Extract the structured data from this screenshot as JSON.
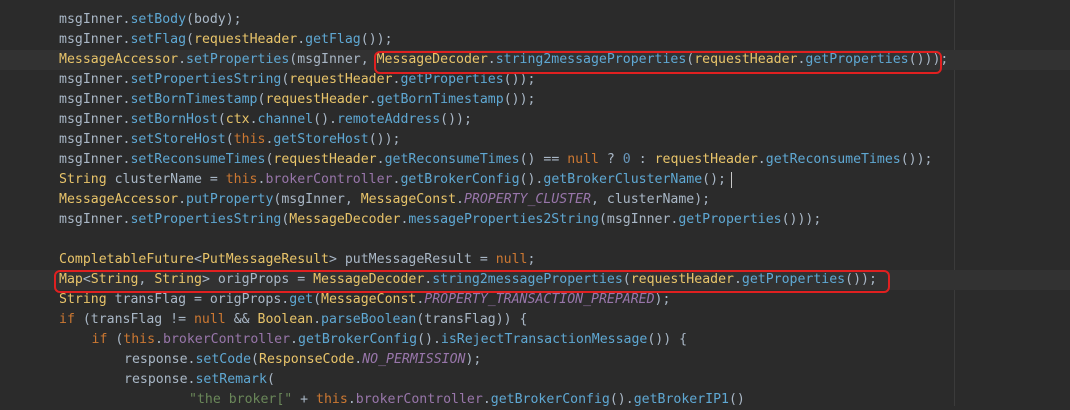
{
  "editor": {
    "lines": [
      {
        "indent": 2,
        "tokens": [
          {
            "t": "msgInner.",
            "c": "default"
          },
          {
            "t": "setBody",
            "c": "mcall"
          },
          {
            "t": "(body);",
            "c": "default"
          }
        ]
      },
      {
        "indent": 2,
        "tokens": [
          {
            "t": "msgInner.",
            "c": "default"
          },
          {
            "t": "setFlag",
            "c": "mcall"
          },
          {
            "t": "(",
            "c": "default"
          },
          {
            "t": "requestHeader",
            "c": "yellowclass"
          },
          {
            "t": ".",
            "c": "default"
          },
          {
            "t": "getFlag",
            "c": "mcall"
          },
          {
            "t": "());",
            "c": "default"
          }
        ]
      },
      {
        "indent": 2,
        "current": true,
        "tokens": [
          {
            "t": "MessageAccessor",
            "c": "yellowclass"
          },
          {
            "t": ".",
            "c": "default"
          },
          {
            "t": "setProperties",
            "c": "mcall"
          },
          {
            "t": "(msgInner, ",
            "c": "default"
          },
          {
            "t": "MessageDecoder",
            "c": "yellowclass"
          },
          {
            "t": ".",
            "c": "default"
          },
          {
            "t": "string2messageProperties",
            "c": "mcall"
          },
          {
            "t": "(",
            "c": "default"
          },
          {
            "t": "requestHeader",
            "c": "yellowclass"
          },
          {
            "t": ".",
            "c": "default"
          },
          {
            "t": "getProperties",
            "c": "mcall"
          },
          {
            "t": "()));",
            "c": "default"
          }
        ]
      },
      {
        "indent": 2,
        "tokens": [
          {
            "t": "msgInner.",
            "c": "default"
          },
          {
            "t": "setPropertiesString",
            "c": "mcall"
          },
          {
            "t": "(",
            "c": "default"
          },
          {
            "t": "requestHeader",
            "c": "yellowclass"
          },
          {
            "t": ".",
            "c": "default"
          },
          {
            "t": "getProperties",
            "c": "mcall"
          },
          {
            "t": "());",
            "c": "default"
          }
        ]
      },
      {
        "indent": 2,
        "tokens": [
          {
            "t": "msgInner.",
            "c": "default"
          },
          {
            "t": "setBornTimestamp",
            "c": "mcall"
          },
          {
            "t": "(",
            "c": "default"
          },
          {
            "t": "requestHeader",
            "c": "yellowclass"
          },
          {
            "t": ".",
            "c": "default"
          },
          {
            "t": "getBornTimestamp",
            "c": "mcall"
          },
          {
            "t": "());",
            "c": "default"
          }
        ]
      },
      {
        "indent": 2,
        "tokens": [
          {
            "t": "msgInner.",
            "c": "default"
          },
          {
            "t": "setBornHost",
            "c": "mcall"
          },
          {
            "t": "(",
            "c": "default"
          },
          {
            "t": "ctx",
            "c": "yellowclass"
          },
          {
            "t": ".",
            "c": "default"
          },
          {
            "t": "channel",
            "c": "mcall"
          },
          {
            "t": "().",
            "c": "default"
          },
          {
            "t": "remoteAddress",
            "c": "mcall"
          },
          {
            "t": "());",
            "c": "default"
          }
        ]
      },
      {
        "indent": 2,
        "tokens": [
          {
            "t": "msgInner.",
            "c": "default"
          },
          {
            "t": "setStoreHost",
            "c": "mcall"
          },
          {
            "t": "(",
            "c": "default"
          },
          {
            "t": "this",
            "c": "keyword"
          },
          {
            "t": ".",
            "c": "default"
          },
          {
            "t": "getStoreHost",
            "c": "mcall"
          },
          {
            "t": "());",
            "c": "default"
          }
        ]
      },
      {
        "indent": 2,
        "tokens": [
          {
            "t": "msgInner.",
            "c": "default"
          },
          {
            "t": "setReconsumeTimes",
            "c": "mcall"
          },
          {
            "t": "(",
            "c": "default"
          },
          {
            "t": "requestHeader",
            "c": "yellowclass"
          },
          {
            "t": ".",
            "c": "default"
          },
          {
            "t": "getReconsumeTimes",
            "c": "mcall"
          },
          {
            "t": "() == ",
            "c": "default"
          },
          {
            "t": "null",
            "c": "keyword"
          },
          {
            "t": " ? ",
            "c": "default"
          },
          {
            "t": "0",
            "c": "number"
          },
          {
            "t": " : ",
            "c": "default"
          },
          {
            "t": "requestHeader",
            "c": "yellowclass"
          },
          {
            "t": ".",
            "c": "default"
          },
          {
            "t": "getReconsumeTimes",
            "c": "mcall"
          },
          {
            "t": "());",
            "c": "default"
          }
        ]
      },
      {
        "indent": 2,
        "caret": true,
        "tokens": [
          {
            "t": "String",
            "c": "yellowclass"
          },
          {
            "t": " clusterName = ",
            "c": "default"
          },
          {
            "t": "this",
            "c": "keyword"
          },
          {
            "t": ".",
            "c": "default"
          },
          {
            "t": "brokerController",
            "c": "field"
          },
          {
            "t": ".",
            "c": "default"
          },
          {
            "t": "getBrokerConfig",
            "c": "mcall"
          },
          {
            "t": "().",
            "c": "default"
          },
          {
            "t": "getBrokerClusterName",
            "c": "mcall"
          },
          {
            "t": "();",
            "c": "default"
          }
        ]
      },
      {
        "indent": 2,
        "tokens": [
          {
            "t": "MessageAccessor",
            "c": "yellowclass"
          },
          {
            "t": ".",
            "c": "default"
          },
          {
            "t": "putProperty",
            "c": "mcall"
          },
          {
            "t": "(msgInner, ",
            "c": "default"
          },
          {
            "t": "MessageConst",
            "c": "yellowclass"
          },
          {
            "t": ".",
            "c": "default"
          },
          {
            "t": "PROPERTY_CLUSTER",
            "c": "static"
          },
          {
            "t": ", clusterName);",
            "c": "default"
          }
        ]
      },
      {
        "indent": 2,
        "tokens": [
          {
            "t": "msgInner.",
            "c": "default"
          },
          {
            "t": "setPropertiesString",
            "c": "mcall"
          },
          {
            "t": "(",
            "c": "default"
          },
          {
            "t": "MessageDecoder",
            "c": "yellowclass"
          },
          {
            "t": ".",
            "c": "default"
          },
          {
            "t": "messageProperties2String",
            "c": "mcall"
          },
          {
            "t": "(msgInner.",
            "c": "default"
          },
          {
            "t": "getProperties",
            "c": "mcall"
          },
          {
            "t": "()));",
            "c": "default"
          }
        ]
      },
      {
        "indent": 0,
        "tokens": []
      },
      {
        "indent": 2,
        "tokens": [
          {
            "t": "CompletableFuture",
            "c": "yellowclass"
          },
          {
            "t": "<",
            "c": "default"
          },
          {
            "t": "PutMessageResult",
            "c": "yellowclass"
          },
          {
            "t": "> putMessageResult = ",
            "c": "default"
          },
          {
            "t": "null",
            "c": "keyword"
          },
          {
            "t": ";",
            "c": "default"
          }
        ]
      },
      {
        "indent": 2,
        "current": true,
        "tokens": [
          {
            "t": "Map",
            "c": "yellowclass"
          },
          {
            "t": "<",
            "c": "default"
          },
          {
            "t": "String",
            "c": "yellowclass"
          },
          {
            "t": ", ",
            "c": "default"
          },
          {
            "t": "String",
            "c": "yellowclass"
          },
          {
            "t": "> origProps = ",
            "c": "default"
          },
          {
            "t": "MessageDecoder",
            "c": "yellowclass"
          },
          {
            "t": ".",
            "c": "default"
          },
          {
            "t": "string2messageProperties",
            "c": "mcall"
          },
          {
            "t": "(",
            "c": "default"
          },
          {
            "t": "requestHeader",
            "c": "yellowclass"
          },
          {
            "t": ".",
            "c": "default"
          },
          {
            "t": "getProperties",
            "c": "mcall"
          },
          {
            "t": "());",
            "c": "default"
          }
        ]
      },
      {
        "indent": 2,
        "tokens": [
          {
            "t": "String",
            "c": "yellowclass"
          },
          {
            "t": " transFlag = origProps.",
            "c": "default"
          },
          {
            "t": "get",
            "c": "mcall"
          },
          {
            "t": "(",
            "c": "default"
          },
          {
            "t": "MessageConst",
            "c": "yellowclass"
          },
          {
            "t": ".",
            "c": "default"
          },
          {
            "t": "PROPERTY_TRANSACTION_PREPARED",
            "c": "static"
          },
          {
            "t": ");",
            "c": "default"
          }
        ]
      },
      {
        "indent": 2,
        "tokens": [
          {
            "t": "if",
            "c": "keyword"
          },
          {
            "t": " (transFlag != ",
            "c": "default"
          },
          {
            "t": "null",
            "c": "keyword"
          },
          {
            "t": " && ",
            "c": "default"
          },
          {
            "t": "Boolean",
            "c": "yellowclass"
          },
          {
            "t": ".",
            "c": "default"
          },
          {
            "t": "parseBoolean",
            "c": "mcall"
          },
          {
            "t": "(transFlag)) {",
            "c": "default"
          }
        ]
      },
      {
        "indent": 3,
        "tokens": [
          {
            "t": "if",
            "c": "keyword"
          },
          {
            "t": " (",
            "c": "default"
          },
          {
            "t": "this",
            "c": "keyword"
          },
          {
            "t": ".",
            "c": "default"
          },
          {
            "t": "brokerController",
            "c": "field"
          },
          {
            "t": ".",
            "c": "default"
          },
          {
            "t": "getBrokerConfig",
            "c": "mcall"
          },
          {
            "t": "().",
            "c": "default"
          },
          {
            "t": "isRejectTransactionMessage",
            "c": "mcall"
          },
          {
            "t": "()) {",
            "c": "default"
          }
        ]
      },
      {
        "indent": 4,
        "tokens": [
          {
            "t": "response.",
            "c": "default"
          },
          {
            "t": "setCode",
            "c": "mcall"
          },
          {
            "t": "(",
            "c": "default"
          },
          {
            "t": "ResponseCode",
            "c": "yellowclass"
          },
          {
            "t": ".",
            "c": "default"
          },
          {
            "t": "NO_PERMISSION",
            "c": "static"
          },
          {
            "t": ");",
            "c": "default"
          }
        ]
      },
      {
        "indent": 4,
        "tokens": [
          {
            "t": "response.",
            "c": "default"
          },
          {
            "t": "setRemark",
            "c": "mcall"
          },
          {
            "t": "(",
            "c": "default"
          }
        ]
      },
      {
        "indent": 6,
        "tokens": [
          {
            "t": "\"the broker[\"",
            "c": "string"
          },
          {
            "t": " + ",
            "c": "default"
          },
          {
            "t": "this",
            "c": "keyword"
          },
          {
            "t": ".",
            "c": "default"
          },
          {
            "t": "brokerController",
            "c": "field"
          },
          {
            "t": ".",
            "c": "default"
          },
          {
            "t": "getBrokerConfig",
            "c": "mcall"
          },
          {
            "t": "().",
            "c": "default"
          },
          {
            "t": "getBrokerIP1",
            "c": "mcall"
          },
          {
            "t": "()",
            "c": "default"
          }
        ]
      }
    ]
  },
  "colors": {
    "background": "#2b2b2b",
    "current_line": "#323232",
    "highlight_box": "#e02020",
    "default_text": "#a9b7c6",
    "method_call": "#5fa8d3",
    "class_name": "#e8c46a",
    "keyword": "#cc7832",
    "number": "#6897bb",
    "field": "#9876aa",
    "string": "#6a8759"
  }
}
